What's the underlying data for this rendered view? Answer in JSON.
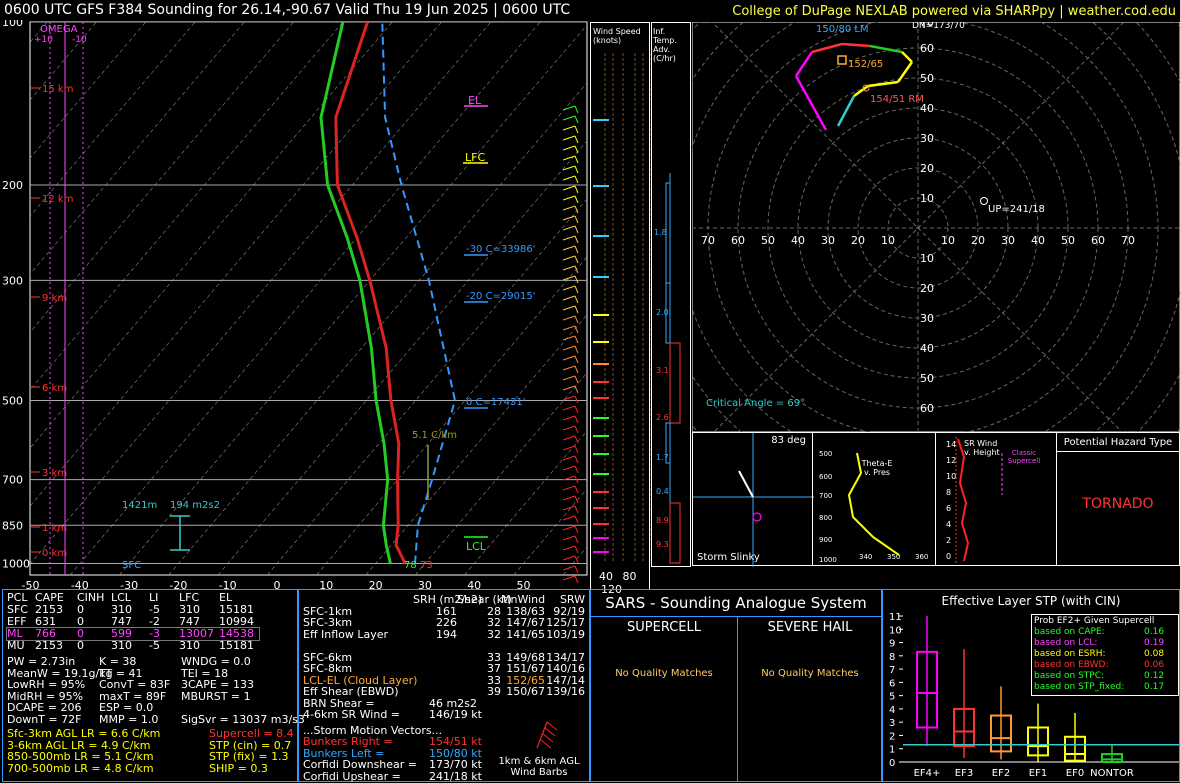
{
  "header": {
    "title": "0600 UTC GFS F384 Sounding for 26.14,-90.67 Valid  Thu 19 Jun 2025 | 0600 UTC",
    "credit": "College of DuPage NEXLAB powered via SHARPpy | weather.cod.edu"
  },
  "colors": {
    "temp": "#dd2222",
    "dew": "#22cc22",
    "virtual": "#dd2222",
    "wetbulb": "#33aaff",
    "parcel": "#3399ff",
    "isotherm": "#cccccc",
    "bg": "#000000"
  },
  "skewt": {
    "pressure_levels": [
      100,
      200,
      300,
      500,
      700,
      850,
      1000
    ],
    "temp_ticks": [
      -50,
      -40,
      -30,
      -20,
      -10,
      0,
      10,
      20,
      30,
      40,
      50
    ],
    "height_labels": [
      "15 km",
      "12 km",
      "9 km",
      "6 km",
      "3 km",
      "1 km",
      "0 km"
    ],
    "omega_label": "OMEGA",
    "omega_ticks": [
      "+10",
      "-10"
    ],
    "el_label": "EL",
    "lfc_label": "LFC",
    "lcl_label": "LCL",
    "sfc_label": "SFC",
    "sfc_temp": "78",
    "sfc_dew": "73",
    "isotherm_labels": [
      "-30 C=33986'",
      "-20 C=29015'",
      "0 C=17431'"
    ],
    "lapse_label": "5.1 C/km",
    "effective_layer_base": "1421m",
    "effective_srh": "194 m2s2"
  },
  "chart_data": [
    {
      "type": "line",
      "title": "0600 UTC GFS F384 Sounding for 26.14,-90.67 Valid  Thu 19 Jun 2025 | 0600 UTC",
      "xlabel": "",
      "ylabel": "",
      "pressure_axis": [
        1000,
        850,
        700,
        500,
        300,
        200,
        100
      ],
      "x_ticks": [
        -50,
        -40,
        -30,
        -20,
        -10,
        0,
        10,
        20,
        30,
        40,
        50
      ],
      "series": [
        {
          "name": "temperature",
          "p": [
            1000,
            925,
            850,
            700,
            600,
            500,
            400,
            300,
            250,
            200,
            150,
            100
          ],
          "t": [
            26,
            21,
            18,
            10,
            4,
            -5,
            -15,
            -30,
            -40,
            -53,
            -65,
            -75
          ]
        },
        {
          "name": "dewpoint",
          "p": [
            1000,
            925,
            850,
            700,
            600,
            500,
            400,
            300,
            250,
            200,
            150,
            100
          ],
          "t": [
            23,
            19,
            15,
            8,
            1,
            -8,
            -18,
            -32,
            -42,
            -55,
            -68,
            -80
          ]
        }
      ]
    },
    {
      "type": "scatter",
      "title": "",
      "xlim": [
        -70,
        70
      ],
      "ylim": [
        -70,
        70
      ],
      "x_ticks": [
        70,
        60,
        50,
        40,
        30,
        20,
        10,
        10,
        20,
        30,
        40,
        50,
        60,
        70
      ],
      "y_ticks": [
        70,
        60,
        50,
        40,
        30,
        20,
        10,
        10,
        20,
        30,
        40,
        50,
        60
      ],
      "hodograph": {
        "u": [
          -7,
          -12,
          -18,
          -30,
          -35,
          -28,
          -20,
          -10,
          -5,
          -3,
          -30,
          -35
        ],
        "v": [
          28,
          32,
          30,
          42,
          50,
          60,
          63,
          66,
          62,
          55,
          58,
          60
        ]
      },
      "points": [
        {
          "label": "150/80 LM",
          "u": -26,
          "v": 68
        },
        {
          "label": "152/65",
          "u": -14,
          "v": 58
        },
        {
          "label": "154/51 RM",
          "u": -7,
          "v": 48
        },
        {
          "label": "UP=241/18",
          "u": 16,
          "v": 9
        },
        {
          "label": "DN=173/70",
          "u": -8,
          "v": 70
        }
      ],
      "critical_angle": "Critical Angle = 69°"
    },
    {
      "type": "bar",
      "title": "Effective Layer STP (with CIN)",
      "categories": [
        "EF4+",
        "EF3",
        "EF2",
        "EF1",
        "EF0",
        "NONTOR"
      ],
      "ylim": [
        0,
        11
      ],
      "y_ticks": [
        0,
        1,
        2,
        3,
        4,
        5,
        6,
        7,
        8,
        9,
        10,
        11
      ],
      "boxes": [
        {
          "cat": "EF4+",
          "lo": 1.2,
          "q1": 2.6,
          "med": 5.2,
          "q3": 8.3,
          "hi": 11.0,
          "color": "#ff00ff"
        },
        {
          "cat": "EF3",
          "lo": 0.3,
          "q1": 1.2,
          "med": 2.3,
          "q3": 4.0,
          "hi": 8.5,
          "color": "#ff3333"
        },
        {
          "cat": "EF2",
          "lo": 0.2,
          "q1": 0.8,
          "med": 1.8,
          "q3": 3.5,
          "hi": 5.7,
          "color": "#ff9933"
        },
        {
          "cat": "EF1",
          "lo": 0.0,
          "q1": 0.5,
          "med": 1.2,
          "q3": 2.6,
          "hi": 4.4,
          "color": "#ffff00"
        },
        {
          "cat": "EF0",
          "lo": 0.0,
          "q1": 0.1,
          "med": 0.6,
          "q3": 1.9,
          "hi": 3.7,
          "color": "#ffff00"
        },
        {
          "cat": "NONTOR",
          "lo": 0.0,
          "q1": 0.0,
          "med": 0.2,
          "q3": 0.6,
          "hi": 1.3,
          "color": "#22cc22"
        }
      ],
      "current_value": 1.3
    }
  ],
  "wind_speed": {
    "label": "Wind Speed (knots)",
    "ticks": [
      "40",
      "80",
      "120"
    ]
  },
  "inf_temp": {
    "label": "Inf. Temp. Adv.(C/hr)",
    "values": [
      "1.8",
      "2.0",
      "3.1",
      "2.6",
      "1.7",
      "0.4",
      "8.9",
      "9.3"
    ]
  },
  "slinky": {
    "angle": "83 deg",
    "label": "Storm Slinky"
  },
  "thetae": {
    "label": "Theta-E v. Pres",
    "x_ticks": [
      "340",
      "350",
      "360",
      "37"
    ],
    "p_ticks": [
      "500",
      "600",
      "700",
      "800",
      "900",
      "1000"
    ]
  },
  "srwind": {
    "label": "SR Wind v. Height",
    "classic": "Classic Supercell",
    "y_ticks": [
      "14",
      "12",
      "10",
      "8",
      "6",
      "4",
      "2",
      "0"
    ]
  },
  "hazard": {
    "title": "Potential Hazard Type",
    "value": "TORNADO"
  },
  "parcels": {
    "headers": [
      "PCL",
      "CAPE",
      "CINH",
      "LCL",
      "LI",
      "LFC",
      "EL"
    ],
    "rows": [
      [
        "SFC",
        "2153",
        "0",
        "310",
        "-5",
        "310",
        "15181"
      ],
      [
        "EFF",
        "631",
        "0",
        "747",
        "-2",
        "747",
        "10994"
      ],
      [
        "ML",
        "766",
        "0",
        "599",
        "-3",
        "13007",
        "14538"
      ],
      [
        "MU",
        "2153",
        "0",
        "310",
        "-5",
        "310",
        "15181"
      ]
    ]
  },
  "thermo": [
    [
      "PW = 2.73in",
      "K = 38",
      "WNDG = 0.0"
    ],
    [
      "MeanW = 19.1g/kg",
      "TT = 41",
      "TEI = 18"
    ],
    [
      "LowRH = 95%",
      "ConvT = 83F",
      "3CAPE = 133"
    ],
    [
      "MidRH = 95%",
      "maxT = 89F",
      "MBURST = 1"
    ],
    [
      "DCAPE = 206",
      "ESP = 0.0",
      ""
    ],
    [
      "DownT = 72F",
      "MMP = 1.0",
      "SigSvr = 13037 m3/s3"
    ]
  ],
  "lapse": [
    {
      "text": "Sfc-3km AGL LR = 6.6 C/km",
      "color": "#ffff00"
    },
    {
      "text": "3-6km AGL LR = 4.9 C/km",
      "color": "#ffff00"
    },
    {
      "text": "850-500mb LR = 5.1 C/km",
      "color": "#ffff00"
    },
    {
      "text": "700-500mb LR = 4.8 C/km",
      "color": "#ffff00"
    }
  ],
  "composite": [
    {
      "text": "Supercell = 8.4",
      "color": "#ff3333"
    },
    {
      "text": "STP (cin) = 0.7",
      "color": "#ffff00"
    },
    {
      "text": "STP (fix) = 1.3",
      "color": "#ffff00"
    },
    {
      "text": "SHIP = 0.3",
      "color": "#ffff00"
    }
  ],
  "kinematics": {
    "headers": [
      "SRH (m2/s2)",
      "Shear (kt)",
      "MnWind",
      "SRW"
    ],
    "rows": [
      [
        "SFC-1km",
        "161",
        "28",
        "138/63",
        "92/19"
      ],
      [
        "SFC-3km",
        "226",
        "32",
        "147/67",
        "125/17"
      ],
      [
        "Eff Inflow Layer",
        "194",
        "32",
        "141/65",
        "103/19"
      ],
      [
        "",
        "",
        "",
        "",
        ""
      ],
      [
        "SFC-6km",
        "33",
        "149/68",
        "134/17",
        ""
      ],
      [
        "SFC-8km",
        "37",
        "151/67",
        "140/16",
        ""
      ],
      [
        "LCL-EL (Cloud Layer)",
        "33",
        "152/65",
        "147/14",
        ""
      ],
      [
        "Eff Shear (EBWD)",
        "39",
        "150/67",
        "139/16",
        ""
      ]
    ],
    "brn": "BRN Shear =",
    "brn_val": "46 m2s2",
    "srw46": "4-6km SR Wind =",
    "srw46_val": "146/19 kt",
    "storm_motion": "...Storm Motion Vectors...",
    "bunkers_right": "Bunkers Right =",
    "bunkers_right_val": "154/51 kt",
    "bunkers_left": "Bunkers Left =",
    "bunkers_left_val": "150/80 kt",
    "corfidi_down": "Corfidi Downshear =",
    "corfidi_down_val": "173/70 kt",
    "corfidi_up": "Corfidi Upshear =",
    "corfidi_up_val": "241/18 kt",
    "barbs_label": "1km & 6km AGL Wind Barbs"
  },
  "sars": {
    "title": "SARS - Sounding Analogue System",
    "supercell": "SUPERCELL",
    "hail": "SEVERE HAIL",
    "no_match1": "No Quality Matches",
    "no_match2": "No Quality Matches"
  },
  "stp_prob": {
    "title": "Prob EF2+ Given Supercell",
    "rows": [
      {
        "label": "based on CAPE:",
        "val": "0.16",
        "color": "#22ff22"
      },
      {
        "label": "based on LCL:",
        "val": "0.19",
        "color": "#ff44ff"
      },
      {
        "label": "based on ESRH:",
        "val": "0.08",
        "color": "#ffff00"
      },
      {
        "label": "based on EBWD:",
        "val": "0.06",
        "color": "#ff3333"
      },
      {
        "label": "based on STPC:",
        "val": "0.12",
        "color": "#22ff22"
      },
      {
        "label": "based on STP_fixed:",
        "val": "0.17",
        "color": "#22ff22"
      }
    ]
  }
}
